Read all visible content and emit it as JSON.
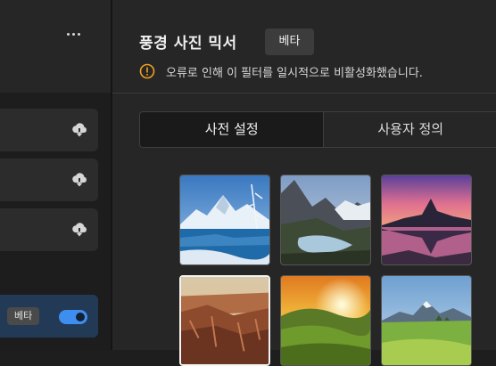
{
  "header": {
    "title": "풍경 사진 믹서",
    "beta_badge": "베타",
    "warning_text": "오류로 인해 이 필터를 일시적으로 비활성화했습니다."
  },
  "tabs": [
    {
      "label": "사전 설정",
      "active": true
    },
    {
      "label": "사용자 정의",
      "active": false
    }
  ],
  "sidebar": {
    "beta_item": {
      "badge": "베타",
      "toggle_on": true
    }
  },
  "thumbnails": [
    {
      "scene": "snowy mountain lake",
      "selected": false
    },
    {
      "scene": "mountain valley river",
      "selected": false
    },
    {
      "scene": "purple peak reflection",
      "selected": false
    },
    {
      "scene": "canyon",
      "selected": true
    },
    {
      "scene": "sunset green hills",
      "selected": false
    },
    {
      "scene": "green meadow mountains",
      "selected": false
    }
  ],
  "colors": {
    "accent": "#3e8ef0",
    "warning": "#f0a020"
  }
}
